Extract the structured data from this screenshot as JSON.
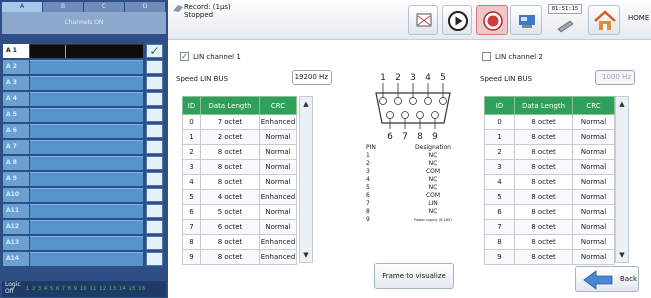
{
  "channel_panel": {
    "tabs": [
      "A",
      "B",
      "C",
      "D"
    ],
    "active_tab": "A",
    "channels_on_label": "Channels ON",
    "rows": [
      {
        "label": "A 1",
        "on": true,
        "checked": true
      },
      {
        "label": "A 2",
        "on": false
      },
      {
        "label": "A 3",
        "on": false
      },
      {
        "label": "A 4",
        "on": false
      },
      {
        "label": "A 5",
        "on": false
      },
      {
        "label": "A 6",
        "on": false
      },
      {
        "label": "A 7",
        "on": false
      },
      {
        "label": "A 8",
        "on": false
      },
      {
        "label": "A 9",
        "on": false
      },
      {
        "label": "A10",
        "on": false
      },
      {
        "label": "A11",
        "on": false
      },
      {
        "label": "A12",
        "on": false
      },
      {
        "label": "A13",
        "on": false
      },
      {
        "label": "A14",
        "on": false
      }
    ],
    "logic_label": "Logic",
    "logic_state": "Off",
    "logic_numbers": "1 2 3 4 5 6 7 8 9 10 11 12 13 14 15 16"
  },
  "topbar": {
    "record_label": "Record: (1µs)",
    "record_status": "Stopped",
    "time_display": "01:51:15",
    "home_label": "HOME"
  },
  "lin1": {
    "enabled": true,
    "title": "LIN channel 1",
    "speed_label": "Speed LIN BUS",
    "speed_value": "19200 Hz",
    "headers": [
      "ID",
      "Data Length",
      "CRC"
    ],
    "rows": [
      [
        "0",
        "7 octet",
        "Enhanced"
      ],
      [
        "1",
        "2 octet",
        "Normal"
      ],
      [
        "2",
        "8 octet",
        "Normal"
      ],
      [
        "3",
        "8 octet",
        "Normal"
      ],
      [
        "4",
        "8 octet",
        "Normal"
      ],
      [
        "5",
        "4 octet",
        "Enhanced"
      ],
      [
        "6",
        "5 octet",
        "Normal"
      ],
      [
        "7",
        "6 octet",
        "Normal"
      ],
      [
        "8",
        "8 octet",
        "Enhanced"
      ],
      [
        "9",
        "8 octet",
        "Enhanced"
      ]
    ]
  },
  "lin2": {
    "enabled": false,
    "title": "LIN channel 2",
    "speed_label": "Speed LIN BUS",
    "speed_value": "1000 Hz",
    "headers": [
      "ID",
      "Data Length",
      "CRC"
    ],
    "rows": [
      [
        "0",
        "8 octet",
        "Normal"
      ],
      [
        "1",
        "8 octet",
        "Normal"
      ],
      [
        "2",
        "8 octet",
        "Normal"
      ],
      [
        "3",
        "8 octet",
        "Normal"
      ],
      [
        "4",
        "8 octet",
        "Normal"
      ],
      [
        "5",
        "8 octet",
        "Normal"
      ],
      [
        "6",
        "8 octet",
        "Normal"
      ],
      [
        "7",
        "8 octet",
        "Normal"
      ],
      [
        "8",
        "8 octet",
        "Normal"
      ],
      [
        "9",
        "8 octet",
        "Normal"
      ]
    ]
  },
  "connector": {
    "top_pins": [
      "1",
      "2",
      "3",
      "4",
      "5"
    ],
    "bottom_pins": [
      "6",
      "7",
      "8",
      "9"
    ],
    "pin_header": "PIN",
    "designation_header": "Designation",
    "pins": [
      {
        "pin": "1",
        "designation": "NC"
      },
      {
        "pin": "2",
        "designation": "NC"
      },
      {
        "pin": "3",
        "designation": "COM"
      },
      {
        "pin": "4",
        "designation": "NC"
      },
      {
        "pin": "5",
        "designation": "NC"
      },
      {
        "pin": "6",
        "designation": "COM"
      },
      {
        "pin": "7",
        "designation": "LIN"
      },
      {
        "pin": "8",
        "designation": "NC"
      },
      {
        "pin": "9",
        "designation": "Power supply (9-18V)"
      }
    ]
  },
  "buttons": {
    "frame_label": "Frame to visualize",
    "back_label": "Back"
  },
  "colors": {
    "panel_blue": "#2e4f86",
    "header_green": "#2fa05a",
    "record_red": "#d43a3a"
  }
}
